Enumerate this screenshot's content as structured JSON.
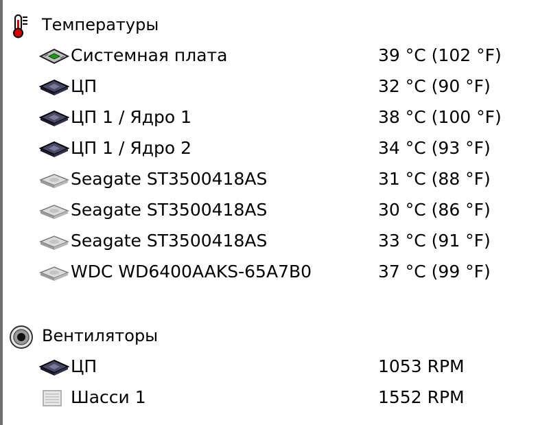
{
  "sensor_tree": {
    "temperatures": {
      "label": "Температуры",
      "icon": "thermometer-icon",
      "items": [
        {
          "label": "Системная плата",
          "value": "39 °C  (102 °F)",
          "icon": "motherboard-icon"
        },
        {
          "label": "ЦП",
          "value": "32 °C  (90 °F)",
          "icon": "cpu-chip-icon"
        },
        {
          "label": "ЦП 1 / Ядро 1",
          "value": "38 °C  (100 °F)",
          "icon": "cpu-chip-icon"
        },
        {
          "label": "ЦП 1 / Ядро 2",
          "value": "34 °C  (93 °F)",
          "icon": "cpu-chip-icon"
        },
        {
          "label": "Seagate ST3500418AS",
          "value": "31 °C  (88 °F)",
          "icon": "hard-drive-icon"
        },
        {
          "label": "Seagate ST3500418AS",
          "value": "30 °C  (86 °F)",
          "icon": "hard-drive-icon"
        },
        {
          "label": "Seagate ST3500418AS",
          "value": "33 °C  (91 °F)",
          "icon": "hard-drive-icon"
        },
        {
          "label": "WDC WD6400AAKS-65A7B0",
          "value": "37 °C  (99 °F)",
          "icon": "hard-drive-icon"
        }
      ]
    },
    "fans": {
      "label": "Вентиляторы",
      "icon": "fan-icon",
      "items": [
        {
          "label": "ЦП",
          "value": "1053 RPM",
          "icon": "cpu-chip-icon"
        },
        {
          "label": "Шасси 1",
          "value": "1552 RPM",
          "icon": "chassis-icon"
        }
      ]
    }
  }
}
